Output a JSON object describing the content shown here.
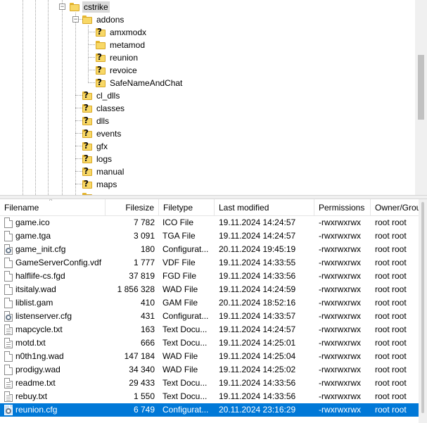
{
  "tree": {
    "root": "cstrike",
    "addons_label": "addons",
    "addons_children": [
      "amxmodx",
      "metamod",
      "reunion",
      "revoice",
      "SafeNameAndChat"
    ],
    "cstrike_children": [
      "cl_dlls",
      "classes",
      "dlls",
      "events",
      "gfx",
      "logs",
      "manual",
      "maps"
    ]
  },
  "columns": {
    "filename": "Filename",
    "filesize": "Filesize",
    "filetype": "Filetype",
    "modified": "Last modified",
    "permissions": "Permissions",
    "owner": "Owner/Grou"
  },
  "files": [
    {
      "name": "game.ico",
      "size": "7 782",
      "type": "ICO File",
      "modified": "19.11.2024 14:24:57",
      "perms": "-rwxrwxrwx",
      "owner": "root root",
      "icon": "file-icon"
    },
    {
      "name": "game.tga",
      "size": "3 091",
      "type": "TGA File",
      "modified": "19.11.2024 14:24:57",
      "perms": "-rwxrwxrwx",
      "owner": "root root",
      "icon": "file-icon"
    },
    {
      "name": "game_init.cfg",
      "size": "180",
      "type": "Configurat...",
      "modified": "20.11.2024 19:45:19",
      "perms": "-rwxrwxrwx",
      "owner": "root root",
      "icon": "config-file-icon"
    },
    {
      "name": "GameServerConfig.vdf",
      "size": "1 777",
      "type": "VDF File",
      "modified": "19.11.2024 14:33:55",
      "perms": "-rwxrwxrwx",
      "owner": "root root",
      "icon": "file-icon"
    },
    {
      "name": "halflife-cs.fgd",
      "size": "37 819",
      "type": "FGD File",
      "modified": "19.11.2024 14:33:56",
      "perms": "-rwxrwxrwx",
      "owner": "root root",
      "icon": "file-icon"
    },
    {
      "name": "itsitaly.wad",
      "size": "1 856 328",
      "type": "WAD File",
      "modified": "19.11.2024 14:24:59",
      "perms": "-rwxrwxrwx",
      "owner": "root root",
      "icon": "file-icon"
    },
    {
      "name": "liblist.gam",
      "size": "410",
      "type": "GAM File",
      "modified": "20.11.2024 18:52:16",
      "perms": "-rwxrwxrwx",
      "owner": "root root",
      "icon": "file-icon"
    },
    {
      "name": "listenserver.cfg",
      "size": "431",
      "type": "Configurat...",
      "modified": "19.11.2024 14:33:57",
      "perms": "-rwxrwxrwx",
      "owner": "root root",
      "icon": "config-file-icon"
    },
    {
      "name": "mapcycle.txt",
      "size": "163",
      "type": "Text Docu...",
      "modified": "19.11.2024 14:24:57",
      "perms": "-rwxrwxrwx",
      "owner": "root root",
      "icon": "text-file-icon"
    },
    {
      "name": "motd.txt",
      "size": "666",
      "type": "Text Docu...",
      "modified": "19.11.2024 14:25:01",
      "perms": "-rwxrwxrwx",
      "owner": "root root",
      "icon": "text-file-icon"
    },
    {
      "name": "n0th1ng.wad",
      "size": "147 184",
      "type": "WAD File",
      "modified": "19.11.2024 14:25:04",
      "perms": "-rwxrwxrwx",
      "owner": "root root",
      "icon": "file-icon"
    },
    {
      "name": "prodigy.wad",
      "size": "34 340",
      "type": "WAD File",
      "modified": "19.11.2024 14:25:02",
      "perms": "-rwxrwxrwx",
      "owner": "root root",
      "icon": "file-icon"
    },
    {
      "name": "readme.txt",
      "size": "29 433",
      "type": "Text Docu...",
      "modified": "19.11.2024 14:33:56",
      "perms": "-rwxrwxrwx",
      "owner": "root root",
      "icon": "text-file-icon"
    },
    {
      "name": "rebuy.txt",
      "size": "1 550",
      "type": "Text Docu...",
      "modified": "19.11.2024 14:33:56",
      "perms": "-rwxrwxrwx",
      "owner": "root root",
      "icon": "text-file-icon"
    },
    {
      "name": "reunion.cfg",
      "size": "6 749",
      "type": "Configurat...",
      "modified": "20.11.2024 23:16:29",
      "perms": "-rwxrwxrwx",
      "owner": "root root",
      "icon": "config-file-icon"
    }
  ],
  "selected_file": "reunion.cfg",
  "colors": {
    "selection": "#0078d7",
    "folder": "#f8d866"
  }
}
